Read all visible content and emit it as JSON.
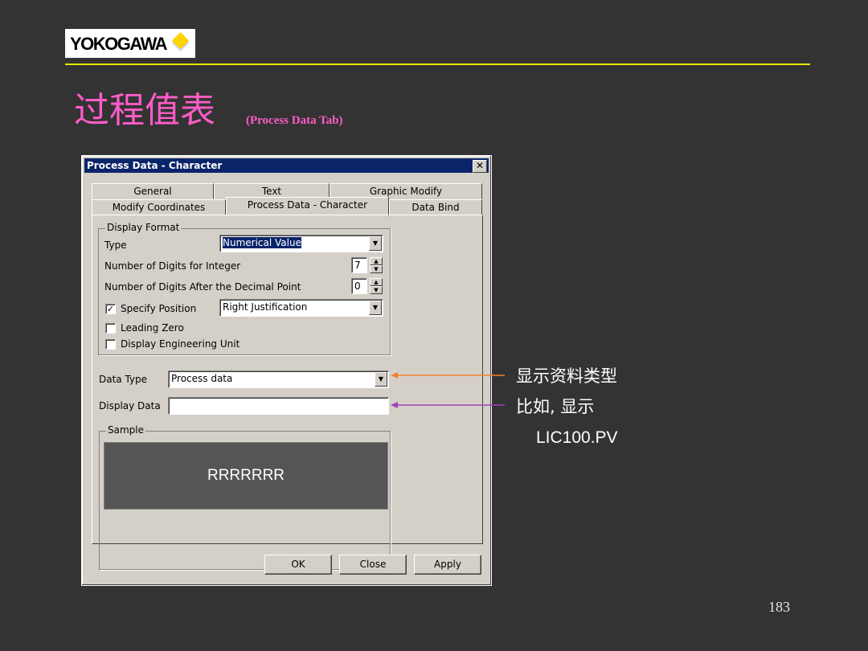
{
  "logo": {
    "text": "YOKOGAWA"
  },
  "slide": {
    "title": "过程值表",
    "subtitle": "(Process Data Tab)",
    "page_number": "183"
  },
  "dialog": {
    "title": "Process Data - Character",
    "close_glyph": "✕",
    "tabs_back": [
      "General",
      "Text",
      "Graphic Modify"
    ],
    "tabs_front": [
      "Modify Coordinates",
      "Process Data - Character",
      "Data Bind"
    ],
    "display_format": {
      "group_label": "Display Format",
      "type_label": "Type",
      "type_value": "Numerical Value",
      "int_digits_label": "Number of Digits for Integer",
      "int_digits_value": "7",
      "dec_digits_label": "Number of Digits After the Decimal Point",
      "dec_digits_value": "0",
      "specify_position_label": "Specify Position",
      "specify_position_checked": true,
      "position_value": "Right Justification",
      "leading_zero_label": "Leading Zero",
      "leading_zero_checked": false,
      "eng_unit_label": "Display Engineering Unit",
      "eng_unit_checked": false
    },
    "data_type_label": "Data Type",
    "data_type_value": "Process data",
    "display_data_label": "Display Data",
    "display_data_value": "",
    "sample_label": "Sample",
    "sample_text": "RRRRRRR",
    "buttons": {
      "ok": "OK",
      "close": "Close",
      "apply": "Apply"
    },
    "check_glyph": "✓",
    "dropdown_glyph": "▼",
    "spin_up_glyph": "▲",
    "spin_down_glyph": "▼"
  },
  "annotations": {
    "data_type_note": "显示资料类型",
    "display_data_note_1": "比如, 显示",
    "display_data_note_2": "LIC100.PV",
    "orange_arrow_color": "#f08030",
    "purple_arrow_color": "#a040c0"
  }
}
